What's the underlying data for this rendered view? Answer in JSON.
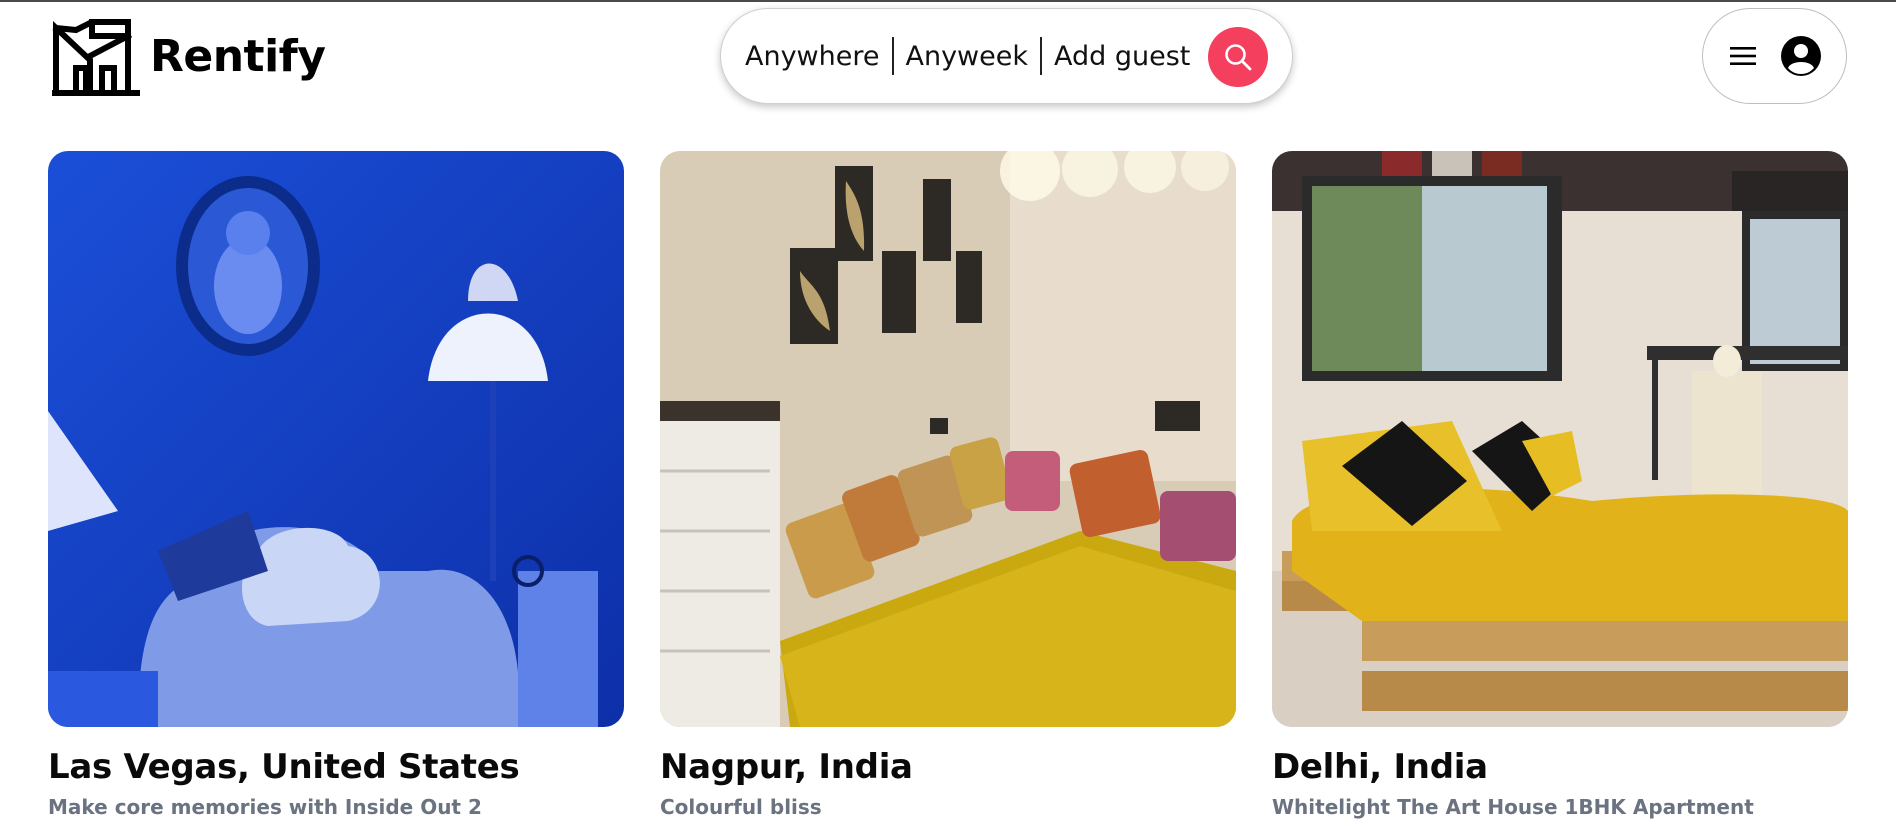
{
  "app": {
    "name": "Rentify"
  },
  "search": {
    "where": "Anywhere",
    "when": "Anyweek",
    "guests": "Add guest",
    "button_color": "#f43f5e"
  },
  "user_menu": {
    "icons": [
      "menu-icon",
      "user-avatar-icon"
    ]
  },
  "listings": [
    {
      "title": "Las Vegas, United States",
      "subtitle": "Make core memories with Inside Out 2"
    },
    {
      "title": "Nagpur, India",
      "subtitle": "Colourful bliss"
    },
    {
      "title": "Delhi, India",
      "subtitle": "Whitelight The Art House 1BHK Apartment"
    }
  ]
}
